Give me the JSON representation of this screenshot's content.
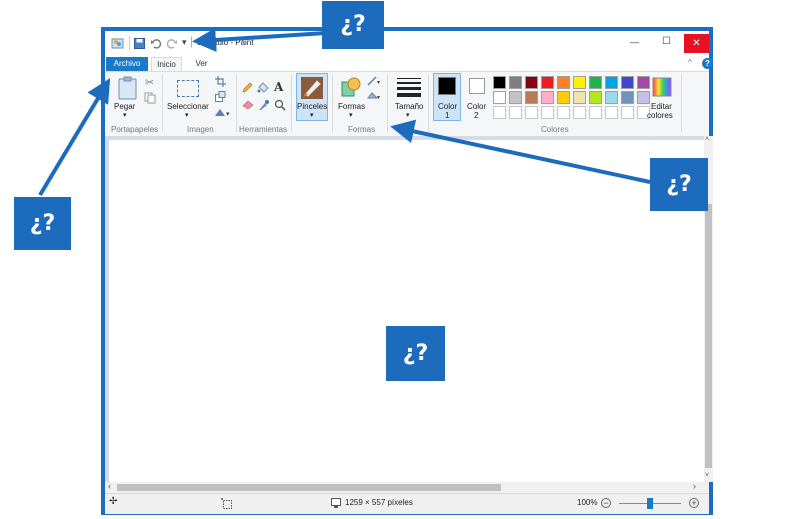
{
  "window": {
    "title": "Sin título - Paint",
    "controls": {
      "minimize": "—",
      "maximize": "☐",
      "close": "✕"
    }
  },
  "tabs": [
    {
      "label": "Archivo"
    },
    {
      "label": "Inicio"
    },
    {
      "label": "Ver"
    }
  ],
  "ribbon": {
    "clipboard": {
      "paste": "Pegar",
      "group": "Portapapeles"
    },
    "image": {
      "select": "Seleccionar",
      "group": "Imagen"
    },
    "tools": {
      "group": "Herramientas"
    },
    "brushes": {
      "label": "Pinceles"
    },
    "shapes": {
      "label": "Formas",
      "group": "Formas"
    },
    "size": {
      "label": "Tamaño"
    },
    "colors": {
      "color1_line1": "Color",
      "color1_line2": "1",
      "color2_line1": "Color",
      "color2_line2": "2",
      "edit_line1": "Editar",
      "edit_line2": "colores",
      "group": "Colores",
      "palette_row1": [
        "#000000",
        "#7f7f7f",
        "#880015",
        "#ed1c24",
        "#ff7f27",
        "#fff200",
        "#22b14c",
        "#00a2e8",
        "#3f48cc",
        "#a349a4"
      ],
      "palette_row2": [
        "#ffffff",
        "#c3c3c3",
        "#b97a57",
        "#ffaec9",
        "#ffc90e",
        "#efe4b0",
        "#b5e61d",
        "#99d9ea",
        "#7092be",
        "#c8bfe7"
      ]
    }
  },
  "statusbar": {
    "dimensions": "1259 × 557 píxeles",
    "zoom": "100%"
  },
  "callouts": {
    "top": "¿?",
    "left": "¿?",
    "right": "¿?",
    "center": "¿?"
  }
}
